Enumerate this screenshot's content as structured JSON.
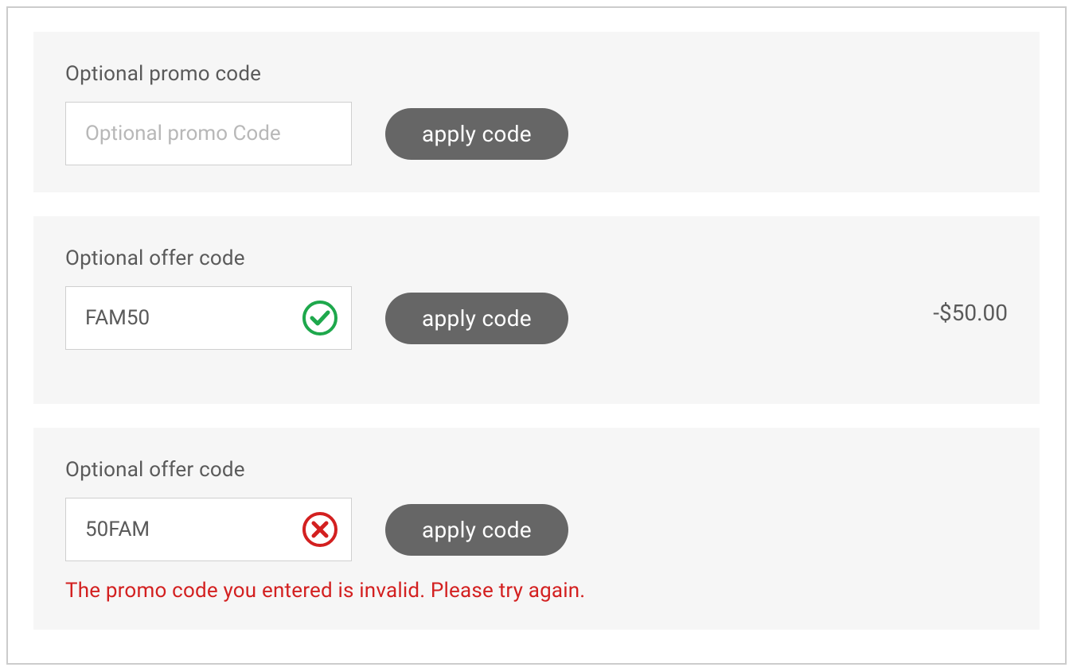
{
  "sections": {
    "promo": {
      "label": "Optional promo code",
      "input_value": "",
      "input_placeholder": "Optional promo Code",
      "button_label": "apply code"
    },
    "valid": {
      "label": "Optional offer code",
      "input_value": "FAM50",
      "input_placeholder": "",
      "button_label": "apply code",
      "discount": "-$50.00"
    },
    "invalid": {
      "label": "Optional offer code",
      "input_value": "50FAM",
      "input_placeholder": "",
      "button_label": "apply code",
      "error_message": "The promo code you entered is invalid. Please try again."
    }
  },
  "colors": {
    "success": "#1ea84c",
    "error": "#d32020",
    "button_bg": "#666666",
    "panel_bg": "#f6f6f6"
  }
}
